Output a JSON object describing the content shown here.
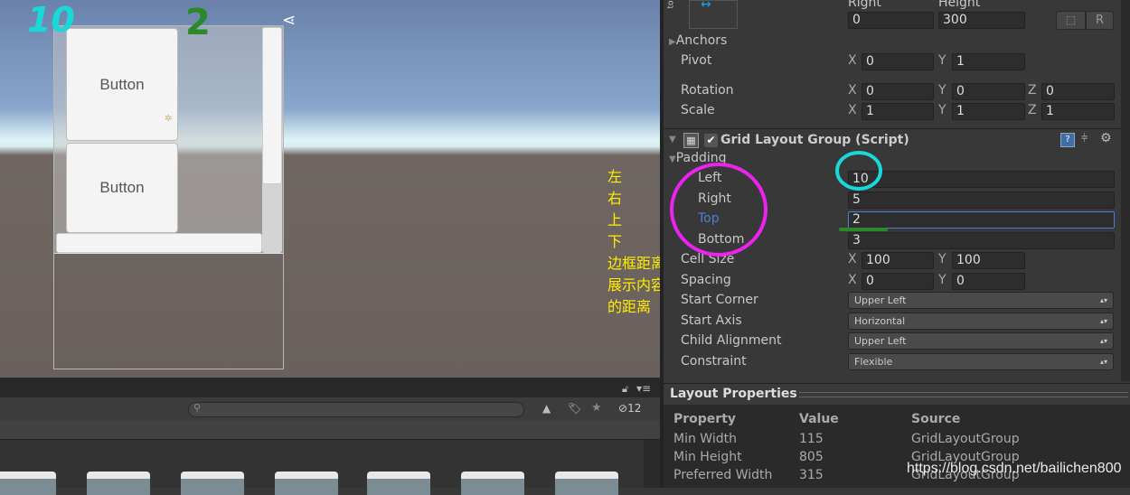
{
  "scene": {
    "buttons": [
      "Button",
      "Button"
    ],
    "annotations": {
      "left_value": "10",
      "top_value": "2"
    },
    "note_lines": [
      "左",
      "右",
      "上",
      "下",
      "边框距离",
      "展示内容",
      "的距离"
    ]
  },
  "project": {
    "filter_count": "12",
    "search_placeholder": ""
  },
  "inspector": {
    "rect": {
      "right_label": "Right",
      "height_label": "Height",
      "right": "0",
      "height": "300",
      "raw_button": "R",
      "side_label": "to"
    },
    "anchors": "Anchors",
    "pivot": {
      "label": "Pivot",
      "x": "0",
      "y": "1"
    },
    "rotation": {
      "label": "Rotation",
      "x": "0",
      "y": "0",
      "z": "0"
    },
    "scale": {
      "label": "Scale",
      "x": "1",
      "y": "1",
      "z": "1"
    },
    "component": {
      "title": "Grid Layout Group (Script)",
      "enabled": true
    },
    "padding": {
      "label": "Padding",
      "left_label": "Left",
      "left": "10",
      "right_label": "Right",
      "right": "5",
      "top_label": "Top",
      "top": "2",
      "bottom_label": "Bottom",
      "bottom": "3"
    },
    "cell_size": {
      "label": "Cell Size",
      "x": "100",
      "y": "100"
    },
    "spacing": {
      "label": "Spacing",
      "x": "0",
      "y": "0"
    },
    "start_corner": {
      "label": "Start Corner",
      "value": "Upper Left"
    },
    "start_axis": {
      "label": "Start Axis",
      "value": "Horizontal"
    },
    "child_alignment": {
      "label": "Child Alignment",
      "value": "Upper Left"
    },
    "constraint": {
      "label": "Constraint",
      "value": "Flexible"
    },
    "axis": {
      "x": "X",
      "y": "Y",
      "z": "Z"
    }
  },
  "layout_properties": {
    "title": "Layout Properties",
    "headers": [
      "Property",
      "Value",
      "Source"
    ],
    "rows": [
      [
        "Min Width",
        "115",
        "GridLayoutGroup"
      ],
      [
        "Min Height",
        "805",
        "GridLayoutGroup"
      ],
      [
        "Preferred Width",
        "315",
        "GridLayoutGroup"
      ]
    ]
  },
  "watermark": "https://blog.csdn.net/bailichen800",
  "colors": {
    "accent_blue": "#4a7fd8",
    "annotation_cyan": "#19d8d8",
    "annotation_green": "#2a8a2a",
    "annotation_magenta": "#ee22ee",
    "note_yellow": "#ffee00"
  }
}
